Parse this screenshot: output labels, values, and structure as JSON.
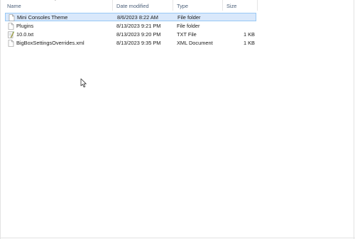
{
  "columns": {
    "name": "Name",
    "date": "Date modified",
    "type": "Type",
    "size": "Size"
  },
  "files": [
    {
      "name": "Mini Consoles Theme",
      "date": "8/6/2023 8:22 AM",
      "type": "File folder",
      "size": "",
      "icon": "folder-icon",
      "selected": true
    },
    {
      "name": "Plugins",
      "date": "8/13/2023 9:21 PM",
      "type": "File folder",
      "size": "",
      "icon": "folder-icon",
      "selected": false
    },
    {
      "name": "10.0.txt",
      "date": "8/13/2023 9:20 PM",
      "type": "TXT File",
      "size": "1 KB",
      "icon": "text-file-icon",
      "selected": false
    },
    {
      "name": "BigBoxSettingsOverrides.xml",
      "date": "8/13/2023 9:35 PM",
      "type": "XML Document",
      "size": "1 KB",
      "icon": "document-icon",
      "selected": false
    }
  ],
  "colors": {
    "header_text": "#4c607a",
    "selection_fill": "#d9e8fb",
    "selection_border": "#99c9f5"
  }
}
